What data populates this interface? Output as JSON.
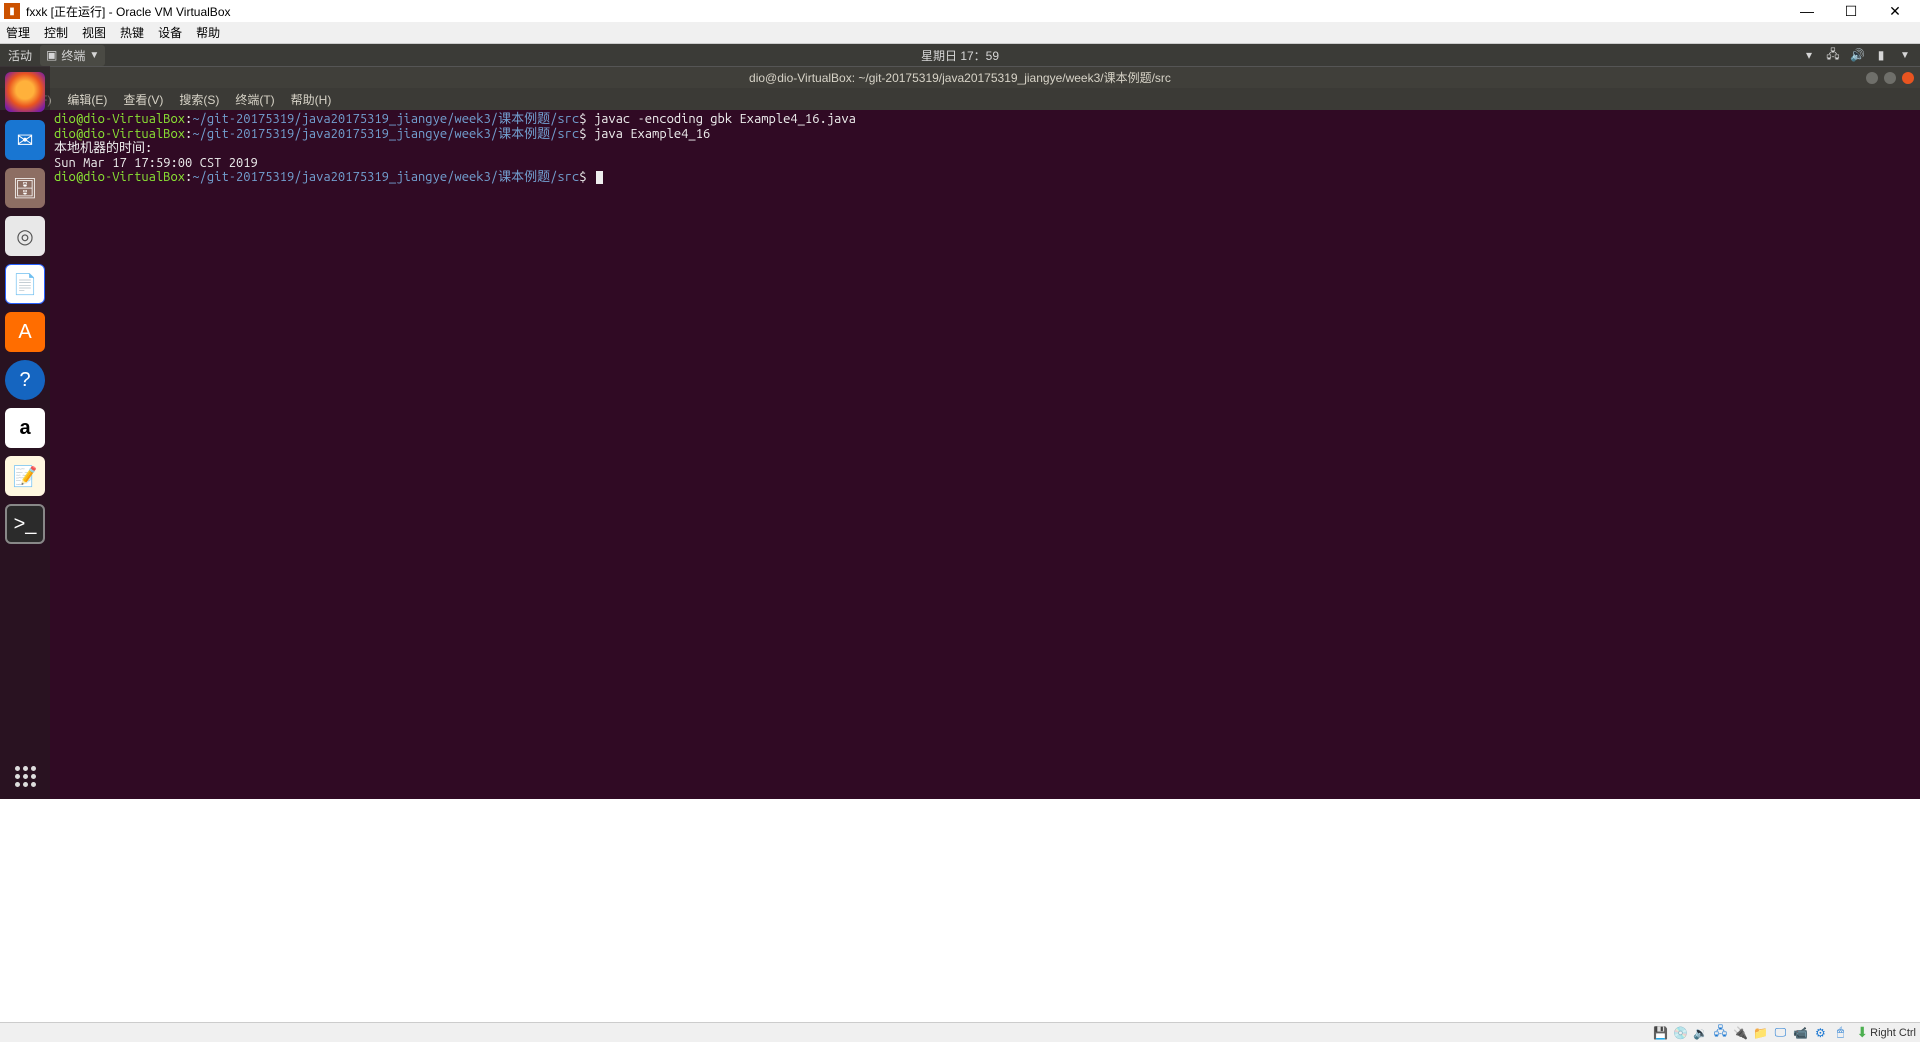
{
  "vbox": {
    "title": "fxxk [正在运行] - Oracle VM VirtualBox",
    "menu": [
      "管理",
      "控制",
      "视图",
      "热键",
      "设备",
      "帮助"
    ],
    "statusbar": {
      "hostkey": "Right Ctrl"
    }
  },
  "gnome": {
    "activities": "活动",
    "app_indicator": "终端",
    "chevron": "▼",
    "clock": "星期日 17：59"
  },
  "terminal": {
    "title": "dio@dio-VirtualBox: ~/git-20175319/java20175319_jiangye/week3/课本例题/src",
    "menu": [
      "文件(F)",
      "编辑(E)",
      "查看(V)",
      "搜索(S)",
      "终端(T)",
      "帮助(H)"
    ],
    "lines": [
      {
        "user": "dio@dio-VirtualBox",
        "colon": ":",
        "path_ascii1": "~/git-20175319/java20175319_jiangye/week3/",
        "path_cjk": "课本例题",
        "path_ascii2": "/src",
        "dollar": "$",
        "cmd": " javac -encoding gbk Example4_16.java"
      },
      {
        "user": "dio@dio-VirtualBox",
        "colon": ":",
        "path_ascii1": "~/git-20175319/java20175319_jiangye/week3/",
        "path_cjk": "课本例题",
        "path_ascii2": "/src",
        "dollar": "$",
        "cmd": " java Example4_16"
      }
    ],
    "output1": "本地机器的时间:",
    "output2": "Sun Mar 17 17:59:00 CST 2019",
    "prompt3": {
      "user": "dio@dio-VirtualBox",
      "colon": ":",
      "path_ascii1": "~/git-20175319/java20175319_jiangye/week3/",
      "path_cjk": "课本例题",
      "path_ascii2": "/src",
      "dollar": "$"
    }
  },
  "dock_items": [
    {
      "name": "firefox",
      "glyph": ""
    },
    {
      "name": "thunderbird",
      "glyph": "✉"
    },
    {
      "name": "files",
      "glyph": "🗄"
    },
    {
      "name": "rhythmbox",
      "glyph": "◎"
    },
    {
      "name": "writer",
      "glyph": "📄"
    },
    {
      "name": "software",
      "glyph": "A"
    },
    {
      "name": "help",
      "glyph": "?"
    },
    {
      "name": "amazon",
      "glyph": "a"
    },
    {
      "name": "editor",
      "glyph": "📝"
    },
    {
      "name": "terminal",
      "glyph": ">_"
    }
  ]
}
